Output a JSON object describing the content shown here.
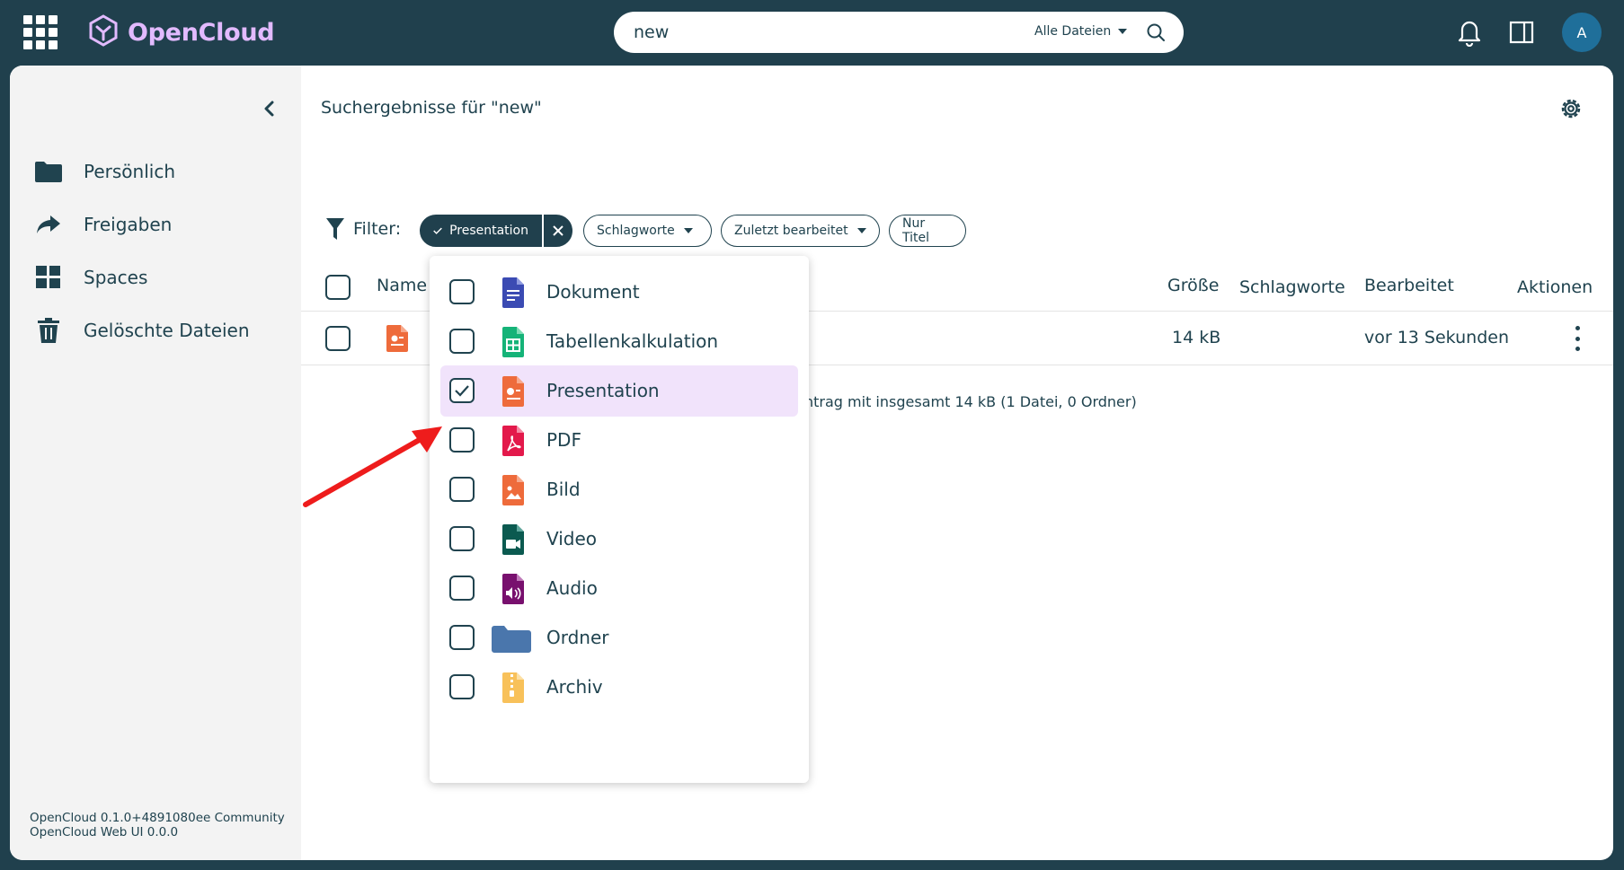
{
  "app": {
    "name": "OpenCloud",
    "brand_color": "#e2baff",
    "topbar_color": "#20404d"
  },
  "search": {
    "value": "new",
    "scope": "Alle Dateien"
  },
  "user": {
    "initial": "A",
    "avatar_color": "#1f6f9a"
  },
  "sidebar": {
    "items": [
      {
        "label": "Persönlich",
        "icon": "folder-icon"
      },
      {
        "label": "Freigaben",
        "icon": "share-icon"
      },
      {
        "label": "Spaces",
        "icon": "grid-icon"
      },
      {
        "label": "Gelöschte Dateien",
        "icon": "trash-icon"
      }
    ],
    "version_line1": "OpenCloud 0.1.0+4891080ee Community",
    "version_line2": "OpenCloud Web UI 0.0.0"
  },
  "main": {
    "title": "Suchergebnisse für \"new\"",
    "filter_label": "Filter:",
    "chips": {
      "active": "Presentation",
      "tags": "Schlagworte",
      "edited": "Zuletzt bearbeitet",
      "title_only": "Nur Titel"
    },
    "columns": {
      "name": "Name",
      "size": "Größe",
      "tags": "Schlagworte",
      "modified": "Bearbeitet",
      "actions": "Aktionen"
    },
    "rows": [
      {
        "size": "14 kB",
        "modified": "vor 13 Sekunden"
      }
    ],
    "summary": "ntrag mit insgesamt 14 kB (1 Datei, 0 Ordner)"
  },
  "type_filter": {
    "options": [
      {
        "label": "Dokument",
        "icon": "document-icon",
        "color": "#3b4bb3",
        "checked": false
      },
      {
        "label": "Tabellenkalkulation",
        "icon": "spreadsheet-icon",
        "color": "#15b378",
        "checked": false
      },
      {
        "label": "Presentation",
        "icon": "presentation-icon",
        "color": "#ee6b3b",
        "checked": true
      },
      {
        "label": "PDF",
        "icon": "pdf-icon",
        "color": "#e3194b",
        "checked": false
      },
      {
        "label": "Bild",
        "icon": "image-icon",
        "color": "#ee6b3b",
        "checked": false
      },
      {
        "label": "Video",
        "icon": "video-icon",
        "color": "#0b5a50",
        "checked": false
      },
      {
        "label": "Audio",
        "icon": "audio-icon",
        "color": "#78106e",
        "checked": false
      },
      {
        "label": "Ordner",
        "icon": "folder-icon",
        "color": "#4a76ac",
        "checked": false
      },
      {
        "label": "Archiv",
        "icon": "archive-icon",
        "color": "#f8c15a",
        "checked": false
      }
    ]
  }
}
